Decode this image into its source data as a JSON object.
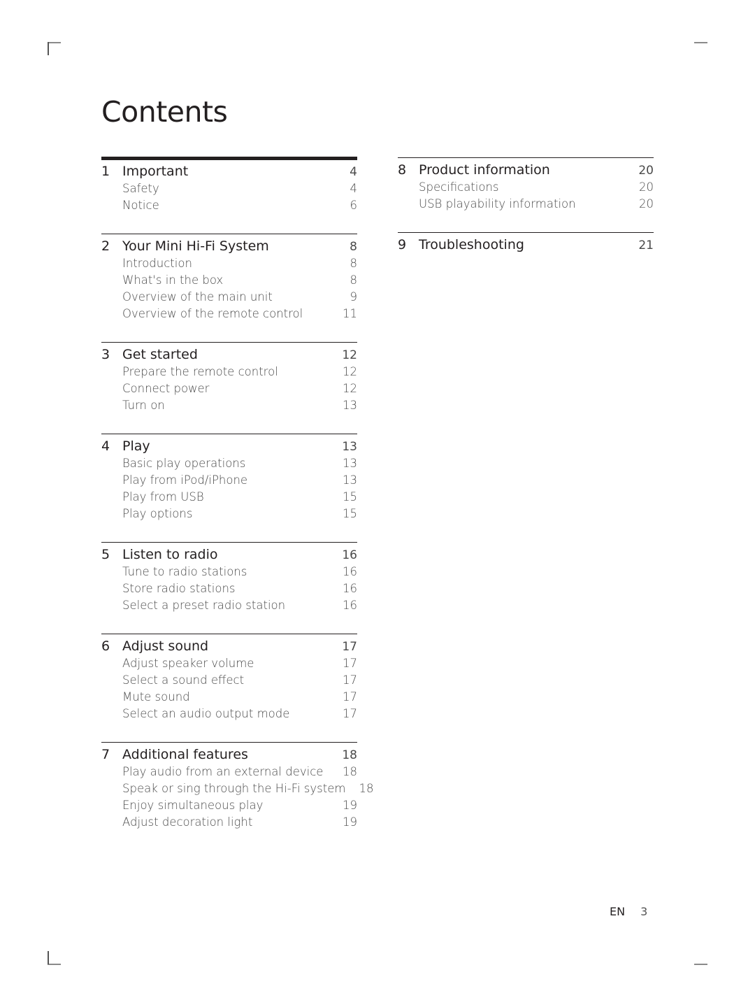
{
  "page": {
    "title": "Contents",
    "footer": {
      "language": "EN",
      "page_number": "3"
    }
  },
  "toc": {
    "left": [
      {
        "number": "1",
        "title": "Important",
        "page": "4",
        "items": [
          {
            "label": "Safety",
            "page": "4"
          },
          {
            "label": "Notice",
            "page": "6"
          }
        ]
      },
      {
        "number": "2",
        "title": "Your Mini Hi-Fi System",
        "page": "8",
        "items": [
          {
            "label": "Introduction",
            "page": "8"
          },
          {
            "label": "What's in the box",
            "page": "8"
          },
          {
            "label": "Overview of the main unit",
            "page": "9"
          },
          {
            "label": "Overview of the remote control",
            "page": "11"
          }
        ]
      },
      {
        "number": "3",
        "title": "Get started",
        "page": "12",
        "items": [
          {
            "label": "Prepare the remote control",
            "page": "12"
          },
          {
            "label": "Connect power",
            "page": "12"
          },
          {
            "label": "Turn on",
            "page": "13"
          }
        ]
      },
      {
        "number": "4",
        "title": "Play",
        "page": "13",
        "items": [
          {
            "label": "Basic play operations",
            "page": "13"
          },
          {
            "label": "Play from iPod/iPhone",
            "page": "13"
          },
          {
            "label": "Play from USB",
            "page": "15"
          },
          {
            "label": "Play options",
            "page": "15"
          }
        ]
      },
      {
        "number": "5",
        "title": "Listen to radio",
        "page": "16",
        "items": [
          {
            "label": "Tune to radio stations",
            "page": "16"
          },
          {
            "label": "Store radio stations",
            "page": "16"
          },
          {
            "label": "Select a preset radio station",
            "page": "16"
          }
        ]
      },
      {
        "number": "6",
        "title": "Adjust sound",
        "page": "17",
        "items": [
          {
            "label": "Adjust speaker volume",
            "page": "17"
          },
          {
            "label": "Select a sound effect",
            "page": "17"
          },
          {
            "label": "Mute sound",
            "page": "17"
          },
          {
            "label": "Select an audio output mode",
            "page": "17"
          }
        ]
      },
      {
        "number": "7",
        "title": "Additional features",
        "page": "18",
        "items": [
          {
            "label": "Play audio from an external device",
            "page": "18"
          },
          {
            "label": "Speak or sing through the Hi-Fi system",
            "page": "18"
          },
          {
            "label": "Enjoy simultaneous play",
            "page": "19"
          },
          {
            "label": "Adjust decoration light",
            "page": "19"
          }
        ]
      }
    ],
    "right": [
      {
        "number": "8",
        "title": "Product information",
        "page": "20",
        "items": [
          {
            "label": "Specifications",
            "page": "20"
          },
          {
            "label": "USB playability information",
            "page": "20"
          }
        ]
      },
      {
        "number": "9",
        "title": "Troubleshooting",
        "page": "21",
        "items": []
      }
    ]
  }
}
